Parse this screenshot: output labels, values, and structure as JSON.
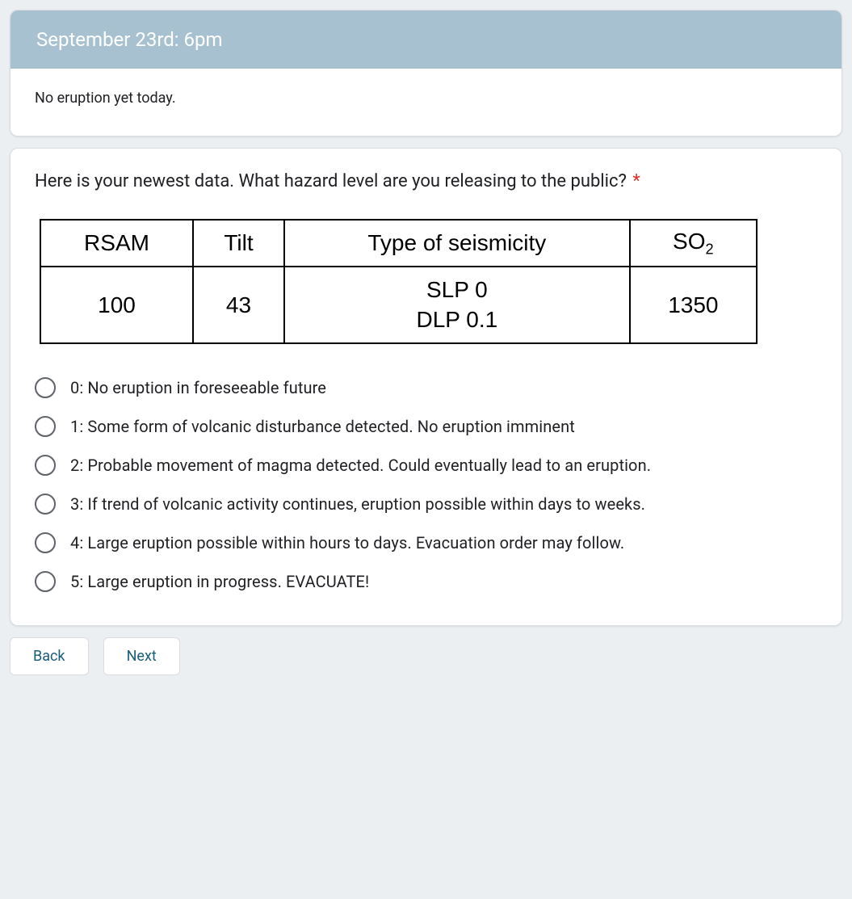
{
  "header": {
    "title": "September 23rd: 6pm"
  },
  "status": "No eruption yet today.",
  "question": {
    "text": "Here is your newest data. What hazard level are you releasing to the public?",
    "required_marker": "*"
  },
  "table": {
    "headers": {
      "rsam": "RSAM",
      "tilt": "Tilt",
      "seismicity": "Type of seismicity",
      "so2_base": "SO",
      "so2_sub": "2"
    },
    "row": {
      "rsam": "100",
      "tilt": "43",
      "seis_line1": "SLP 0",
      "seis_line2": "DLP 0.1",
      "so2": "1350"
    }
  },
  "options": [
    "0: No eruption in foreseeable future",
    "1: Some form of volcanic disturbance detected. No eruption imminent",
    "2: Probable movement of magma detected. Could eventually lead to an eruption.",
    "3: If trend of volcanic activity continues, eruption possible within days to weeks.",
    "4: Large eruption possible within hours to days. Evacuation order may follow.",
    "5: Large eruption in progress. EVACUATE!"
  ],
  "nav": {
    "back": "Back",
    "next": "Next"
  }
}
